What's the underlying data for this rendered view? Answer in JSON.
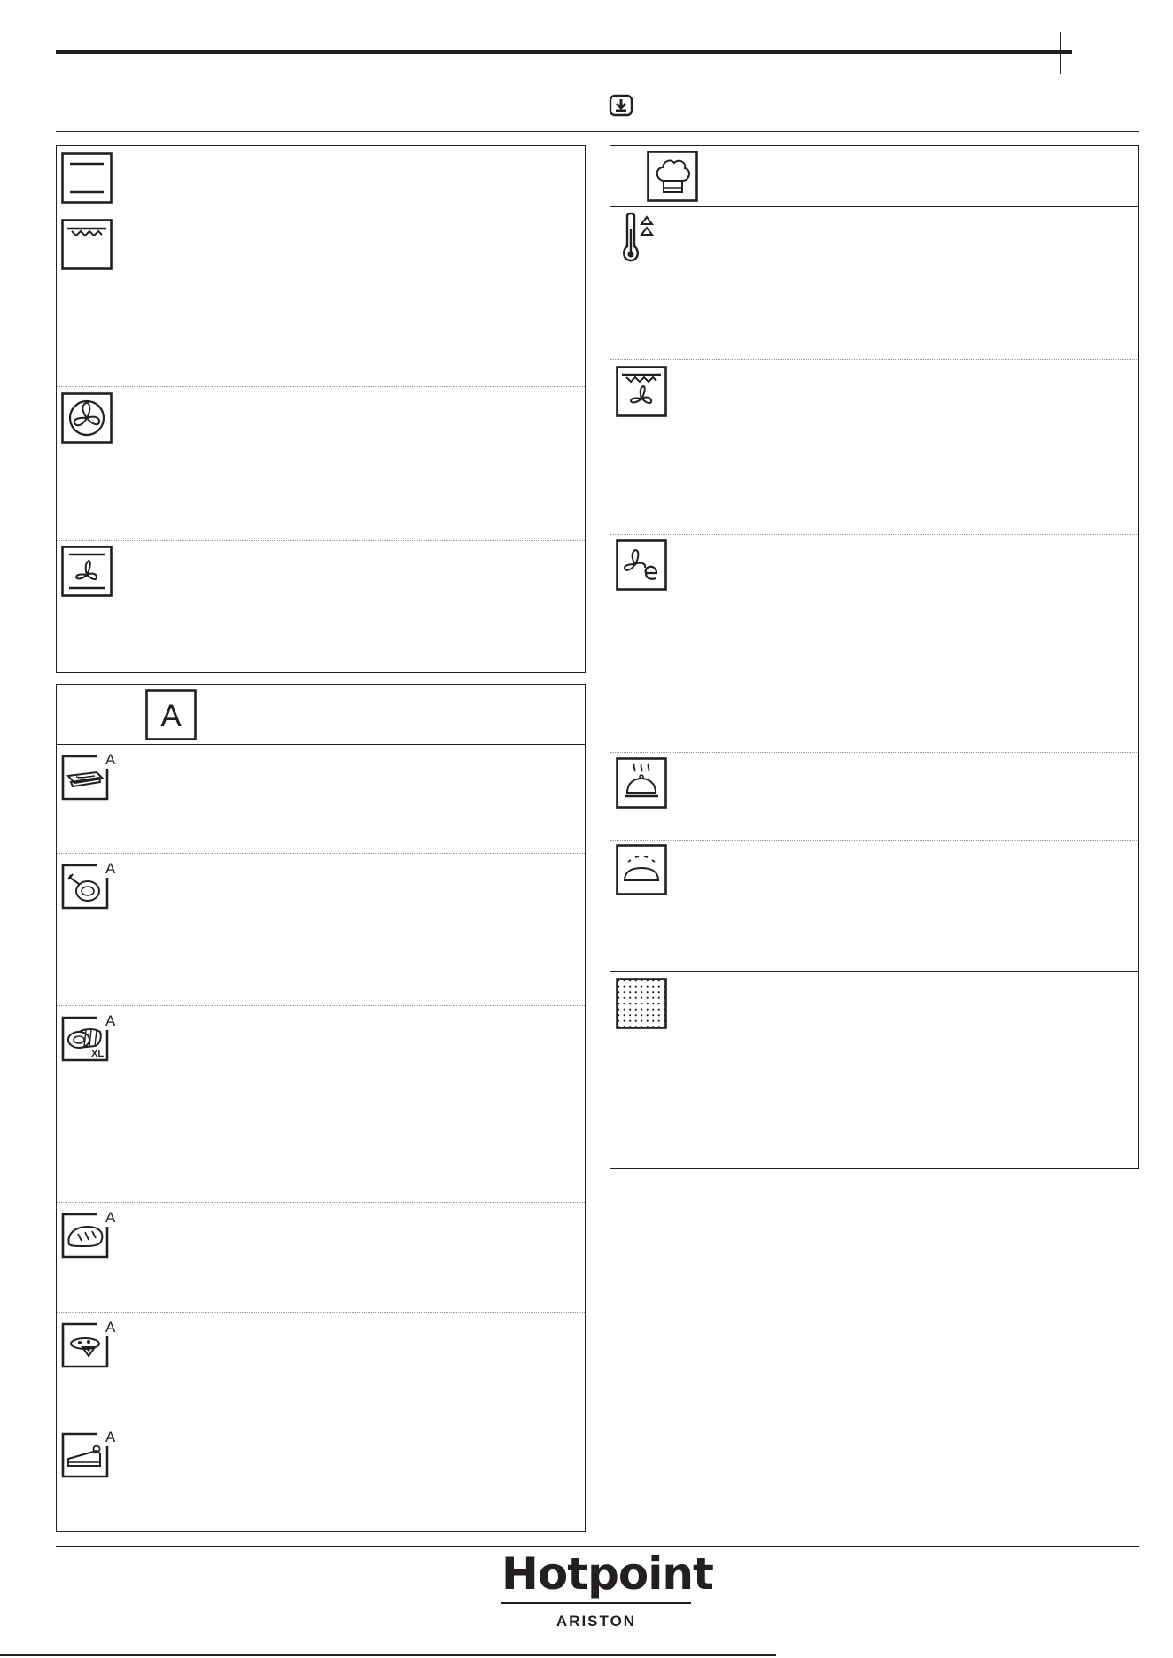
{
  "brand": {
    "name": "Hotpoint",
    "sub": "ARISTON"
  },
  "auto_header": {
    "letter": "A"
  },
  "auto_icon_mark": "A",
  "xl_mark": "XL",
  "icons": {
    "download": "download-icon",
    "left_functions": [
      "top-bottom-heating-icon",
      "grill-icon",
      "forced-air-fan-icon",
      "convection-bake-icon"
    ],
    "auto_functions": [
      "lasagna-dish-icon",
      "roast-chicken-icon",
      "roast-meat-xl-icon",
      "bread-loaf-icon",
      "pizza-icon",
      "cake-slice-icon"
    ],
    "special_header": "chef-hat-icon",
    "special_functions": [
      "fast-preheat-icon",
      "turbo-grill-icon",
      "eco-forced-air-icon",
      "keep-warm-icon",
      "rising-dough-icon",
      "pyrolytic-clean-icon"
    ]
  }
}
